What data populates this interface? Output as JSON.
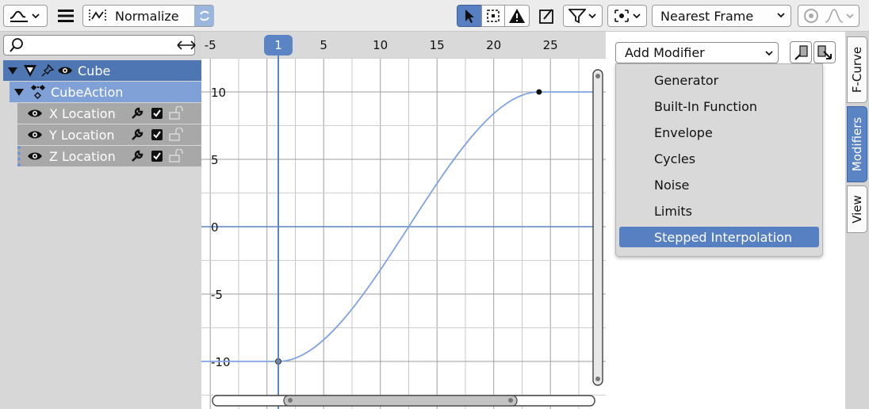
{
  "header": {
    "mode_icon": "curve-editor-icon",
    "normalize_label": "Normalize",
    "snap_label": "Nearest Frame"
  },
  "channels": {
    "search_placeholder": "",
    "object": "Cube",
    "action": "CubeAction",
    "items": [
      {
        "label": "X Location"
      },
      {
        "label": "Y Location"
      },
      {
        "label": "Z Location"
      }
    ]
  },
  "graph": {
    "current_frame": "1",
    "x_ticks": [
      "-5",
      "5",
      "10",
      "15",
      "20",
      "25"
    ],
    "y_ticks": [
      "10",
      "5",
      "0",
      "-5",
      "-10"
    ],
    "curve_color": "#7fa3e0",
    "keyframes": [
      {
        "frame": 1,
        "value": -10
      },
      {
        "frame": 24,
        "value": 10
      }
    ]
  },
  "sidebar": {
    "add_modifier_label": "Add Modifier",
    "menu_items": [
      {
        "label": "Generator"
      },
      {
        "label": "Built-In Function"
      },
      {
        "label": "Envelope"
      },
      {
        "label": "Cycles"
      },
      {
        "label": "Noise"
      },
      {
        "label": "Limits"
      },
      {
        "label": "Stepped Interpolation"
      }
    ],
    "selected_item": "Stepped Interpolation"
  },
  "tabs": [
    {
      "label": "F-Curve"
    },
    {
      "label": "Modifiers"
    },
    {
      "label": "View"
    }
  ],
  "colors": {
    "accent": "#5680c2",
    "selection_row": "#4e76b2"
  }
}
